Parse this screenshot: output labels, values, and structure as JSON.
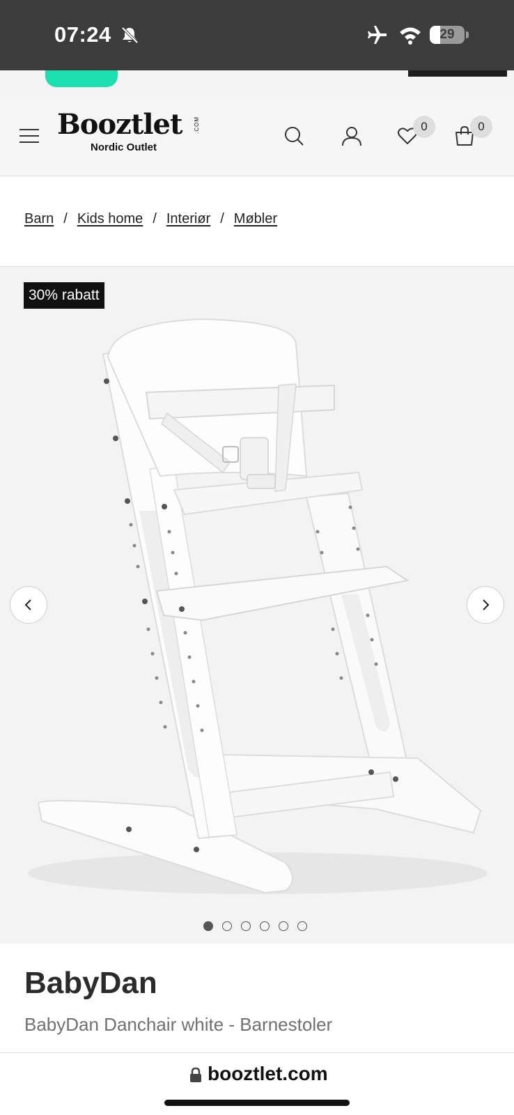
{
  "status_bar": {
    "time": "07:24",
    "battery_level": "29",
    "battery_fraction": 0.29,
    "icons": [
      "bell-slash-icon",
      "airplane-icon",
      "wifi-icon",
      "battery-icon"
    ]
  },
  "header": {
    "logo_text": "Booztlet",
    "logo_suffix": ".COM",
    "logo_tagline": "Nordic Outlet",
    "wishlist_count": "0",
    "cart_count": "0",
    "icons": [
      "hamburger-icon",
      "search-icon",
      "user-icon",
      "heart-icon",
      "bag-icon"
    ]
  },
  "breadcrumb": {
    "items": [
      "Barn",
      "Kids home",
      "Interiør",
      "Møbler"
    ],
    "separator": "/"
  },
  "gallery": {
    "badge": "30% rabatt",
    "image_count": 6,
    "active_index": 0,
    "icons": [
      "chevron-left-icon",
      "chevron-right-icon"
    ]
  },
  "product": {
    "brand": "BabyDan",
    "name": "BabyDan Danchair white - Barnestoler"
  },
  "browser": {
    "url": "booztlet.com"
  },
  "colors": {
    "status_bar": "#3c3c3c",
    "accent_green": "#1de0b0",
    "badge_bg": "#111111",
    "gallery_bg": "#f3f3f3"
  }
}
